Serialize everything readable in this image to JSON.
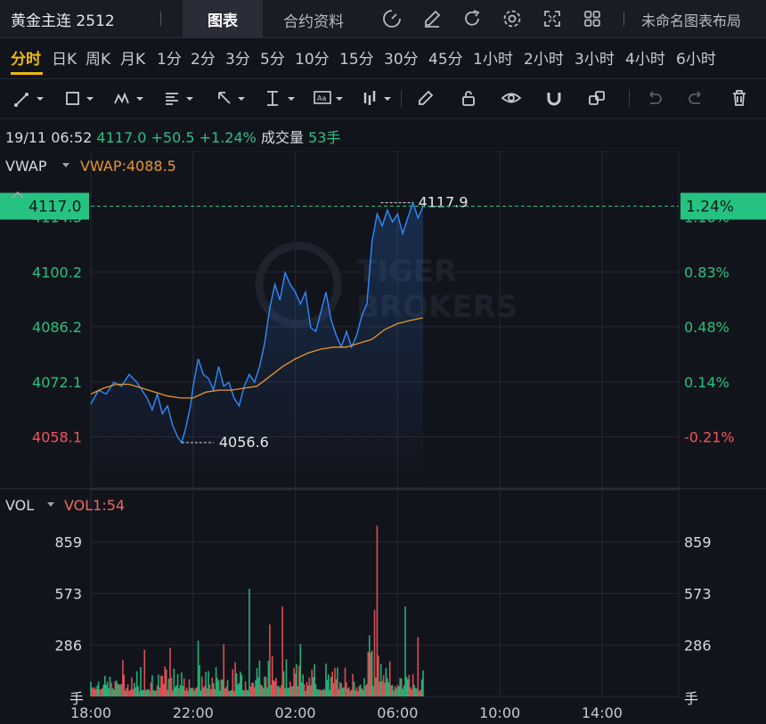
{
  "header": {
    "symbol": "黄金主连 2512",
    "tab_chart": "图表",
    "tab_contract": "合约资料",
    "layout_name": "未命名图表布局",
    "icons": [
      "indicator-icon",
      "edit-icon",
      "refresh-icon",
      "settings-icon",
      "fullscreen-icon",
      "grid-layout-icon"
    ]
  },
  "intervals": [
    "分时",
    "日K",
    "周K",
    "月K",
    "1分",
    "2分",
    "3分",
    "5分",
    "10分",
    "15分",
    "30分",
    "45分",
    "1小时",
    "2小时",
    "3小时",
    "4小时",
    "6小时"
  ],
  "active_interval": 0,
  "toolbar_icons": [
    "trend-line-icon",
    "rectangle-icon",
    "pattern-icon",
    "fib-icon",
    "arrow-icon",
    "measure-icon",
    "text-note-icon",
    "bar-pattern-icon",
    "brush-icon",
    "unlock-icon",
    "eye-icon",
    "magnet-icon",
    "clone-icon",
    "undo-icon",
    "redo-icon",
    "trash-icon"
  ],
  "quote": {
    "datetime": "19/11 06:52",
    "price": "4117.0",
    "change": "+50.5",
    "change_pct": "+1.24%",
    "vol_label": "成交量",
    "vol_value": "53手"
  },
  "colors": {
    "up": "#26c281",
    "down": "#f0555a",
    "line": "#2f8bff",
    "vwap": "#e8962a",
    "vol_label": "#f06a5a"
  },
  "chart_data": {
    "type": "line",
    "indicator_label": "VWAP",
    "indicator_value": "VWAP:4088.5",
    "current_price_tag": "4117.0",
    "current_pct_tag": "1.24%",
    "max_label": "4117.9",
    "min_label": "4056.6",
    "price_ticks": [
      "4100.2",
      "4086.2",
      "4072.1",
      "4058.1"
    ],
    "pct_ticks": [
      "0.83%",
      "0.48%",
      "0.14%",
      "-0.21%"
    ],
    "partial_price_tick": "4114.3",
    "partial_pct_tick": "1.18%",
    "ylim": [
      4045,
      4131
    ],
    "x_ticks": [
      "18:00",
      "22:00",
      "02:00",
      "06:00",
      "10:00",
      "14:00"
    ],
    "x_tick_hours": [
      0,
      4,
      8,
      12,
      16,
      20
    ],
    "x_range_hours": [
      0,
      23
    ],
    "price_series": [
      [
        0.0,
        4066.5
      ],
      [
        0.3,
        4070
      ],
      [
        0.6,
        4069
      ],
      [
        0.9,
        4072
      ],
      [
        1.2,
        4071
      ],
      [
        1.5,
        4074
      ],
      [
        1.8,
        4072
      ],
      [
        2.0,
        4070
      ],
      [
        2.2,
        4068
      ],
      [
        2.4,
        4065
      ],
      [
        2.6,
        4069
      ],
      [
        2.8,
        4064
      ],
      [
        3.0,
        4066
      ],
      [
        3.2,
        4061
      ],
      [
        3.4,
        4058
      ],
      [
        3.55,
        4056.6
      ],
      [
        3.7,
        4060
      ],
      [
        3.9,
        4066
      ],
      [
        4.0,
        4071
      ],
      [
        4.2,
        4078
      ],
      [
        4.4,
        4074
      ],
      [
        4.6,
        4073
      ],
      [
        4.8,
        4070
      ],
      [
        5.0,
        4076
      ],
      [
        5.2,
        4071
      ],
      [
        5.4,
        4072
      ],
      [
        5.6,
        4068
      ],
      [
        5.8,
        4066
      ],
      [
        6.0,
        4071
      ],
      [
        6.2,
        4074
      ],
      [
        6.4,
        4072
      ],
      [
        6.6,
        4076
      ],
      [
        6.8,
        4082
      ],
      [
        7.0,
        4091
      ],
      [
        7.2,
        4097
      ],
      [
        7.4,
        4093
      ],
      [
        7.6,
        4100
      ],
      [
        7.8,
        4097
      ],
      [
        8.0,
        4095
      ],
      [
        8.2,
        4092
      ],
      [
        8.4,
        4095
      ],
      [
        8.6,
        4086
      ],
      [
        8.8,
        4085
      ],
      [
        9.0,
        4090
      ],
      [
        9.2,
        4095
      ],
      [
        9.4,
        4088
      ],
      [
        9.6,
        4084
      ],
      [
        9.8,
        4081
      ],
      [
        10.0,
        4085
      ],
      [
        10.2,
        4081
      ],
      [
        10.4,
        4084
      ],
      [
        10.6,
        4089
      ],
      [
        10.8,
        4092
      ],
      [
        11.0,
        4108
      ],
      [
        11.2,
        4115
      ],
      [
        11.4,
        4112
      ],
      [
        11.6,
        4116
      ],
      [
        11.8,
        4113
      ],
      [
        12.0,
        4115
      ],
      [
        12.2,
        4110
      ],
      [
        12.4,
        4114
      ],
      [
        12.6,
        4117.9
      ],
      [
        12.8,
        4114
      ],
      [
        13.0,
        4117
      ]
    ],
    "vwap_series": [
      [
        0.0,
        4069
      ],
      [
        0.5,
        4070.5
      ],
      [
        1.0,
        4071.5
      ],
      [
        1.5,
        4071.5
      ],
      [
        2.0,
        4070.5
      ],
      [
        2.5,
        4069.5
      ],
      [
        3.0,
        4068.5
      ],
      [
        3.5,
        4068
      ],
      [
        4.0,
        4068
      ],
      [
        4.5,
        4069.5
      ],
      [
        5.0,
        4070
      ],
      [
        5.5,
        4070
      ],
      [
        6.0,
        4070.5
      ],
      [
        6.5,
        4071
      ],
      [
        7.0,
        4073.5
      ],
      [
        7.5,
        4076
      ],
      [
        8.0,
        4078
      ],
      [
        8.5,
        4079.5
      ],
      [
        9.0,
        4080.5
      ],
      [
        9.5,
        4081
      ],
      [
        10.0,
        4081
      ],
      [
        10.5,
        4082
      ],
      [
        11.0,
        4083
      ],
      [
        11.5,
        4085.5
      ],
      [
        12.0,
        4087
      ],
      [
        12.5,
        4087.8
      ],
      [
        13.0,
        4088.5
      ]
    ],
    "volume": {
      "indicator_label": "VOL",
      "indicator_value": "VOL1:54",
      "ticks": [
        "859",
        "573",
        "286"
      ],
      "tick_values": [
        859,
        573,
        286
      ],
      "unit": "手",
      "ylim": [
        0,
        1150
      ],
      "spikes": [
        [
          6.2,
          600
        ],
        [
          7.5,
          500
        ],
        [
          11.2,
          950
        ],
        [
          11.1,
          480
        ],
        [
          12.3,
          500
        ],
        [
          4.2,
          310
        ],
        [
          5.2,
          290
        ],
        [
          3.1,
          270
        ],
        [
          2.1,
          260
        ],
        [
          10.9,
          340
        ],
        [
          12.8,
          330
        ],
        [
          7.0,
          400
        ]
      ]
    }
  }
}
